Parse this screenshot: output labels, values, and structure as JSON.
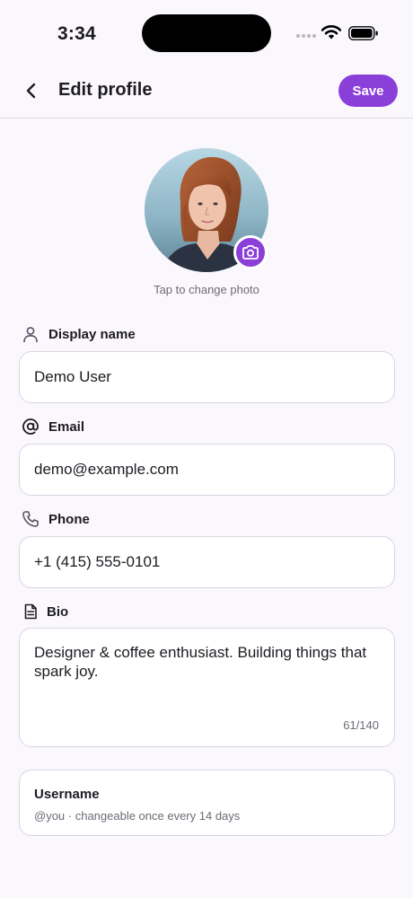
{
  "status_bar": {
    "time": "3:34"
  },
  "header": {
    "title": "Edit profile",
    "save_label": "Save"
  },
  "avatar": {
    "hint": "Tap to change photo"
  },
  "fields": {
    "display_name": {
      "label": "Display name",
      "value": "Demo User"
    },
    "email": {
      "label": "Email",
      "value": "demo@example.com"
    },
    "phone": {
      "label": "Phone",
      "value": "+1 (415) 555-0101"
    },
    "bio": {
      "label": "Bio",
      "value": "Designer & coffee enthusiast. Building things that spark joy.",
      "counter": "61/140"
    }
  },
  "username": {
    "title": "Username",
    "subtitle": "@you · changeable once every 14 days"
  },
  "colors": {
    "accent": "#8b3fd9",
    "background": "#fbf8fd",
    "border": "#d9d4e2",
    "muted_text": "#6e6a76"
  },
  "icons": [
    "back-icon",
    "camera-icon",
    "user-icon",
    "at-icon",
    "phone-icon",
    "document-icon",
    "wifi-icon",
    "battery-icon",
    "signal-icon"
  ]
}
